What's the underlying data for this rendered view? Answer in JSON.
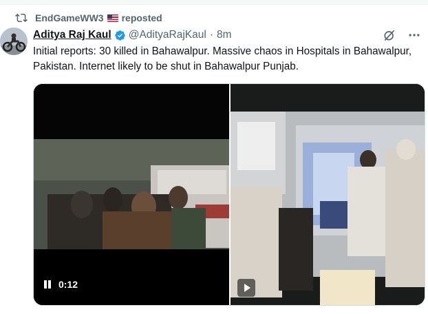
{
  "repost": {
    "icon": "repost-icon",
    "user": "EndGameWW3",
    "flag": "us-flag-emoji",
    "label": "reposted"
  },
  "tweet": {
    "author_name": "Aditya Raj Kaul",
    "verified": true,
    "handle": "@AdityaRajKaul",
    "separator": "·",
    "time": "8m",
    "icons": [
      "grok-icon",
      "more-icon"
    ],
    "text": "Initial reports: 30 killed in Bahawalpur. Massive chaos in Hospitals in Bahawalpur, Pakistan. Internet likely to be shut in Bahawalpur Punjab."
  },
  "media": {
    "videos": [
      {
        "state": "playing",
        "time_label": "0:12",
        "icon": "pause-icon"
      },
      {
        "state": "paused",
        "icon": "play-icon"
      }
    ]
  },
  "colors": {
    "text": "#0f1419",
    "muted": "#536471",
    "verified": "#1d9bf0",
    "border": "#cfd9de"
  }
}
